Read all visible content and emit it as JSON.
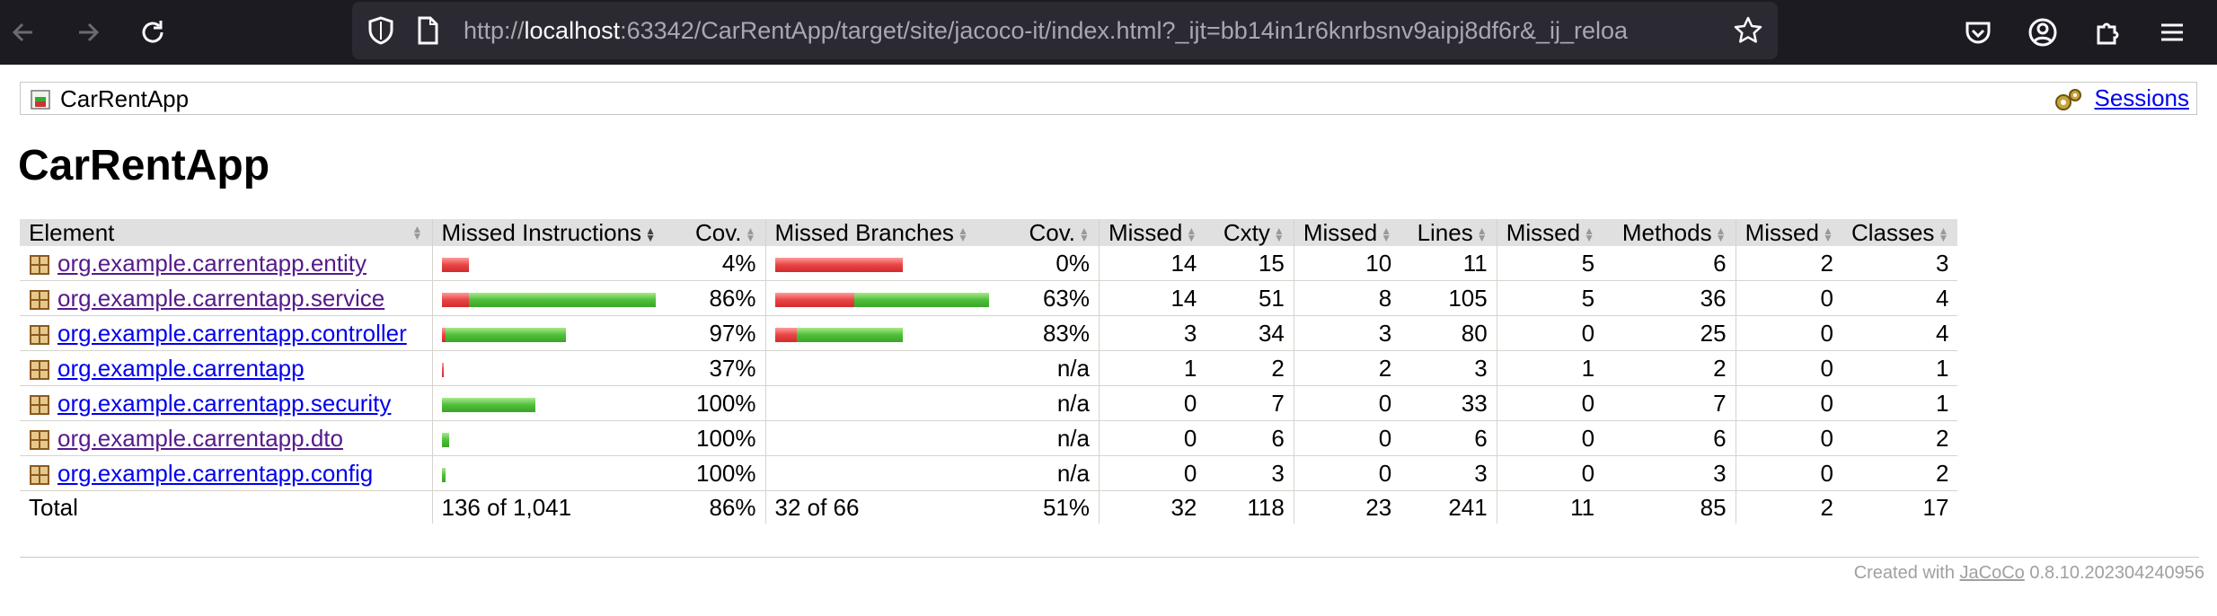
{
  "browser": {
    "url_prefix": "http://",
    "url_host": "localhost",
    "url_rest": ":63342/CarRentApp/target/site/jacoco-it/index.html?_ijt=bb14in1r6knrbsnv9aipj8df6r&_ij_reloa"
  },
  "breadcrumb": {
    "title": "CarRentApp",
    "sessions_label": "Sessions"
  },
  "page_title": "CarRentApp",
  "table": {
    "headers": [
      "Element",
      "Missed Instructions",
      "Cov.",
      "Missed Branches",
      "Cov.",
      "Missed",
      "Cxty",
      "Missed",
      "Lines",
      "Missed",
      "Methods",
      "Missed",
      "Classes"
    ],
    "rows": [
      {
        "name": "org.example.carrentapp.entity",
        "visited": true,
        "instr_bar": {
          "red": 30,
          "green": 0
        },
        "instr_cov": "4%",
        "branch_bar": {
          "red": 142,
          "green": 0
        },
        "branch_cov": "0%",
        "missed_cxty": "14",
        "cxty": "15",
        "missed_lines": "10",
        "lines": "11",
        "missed_methods": "5",
        "methods": "6",
        "missed_classes": "2",
        "classes": "3"
      },
      {
        "name": "org.example.carrentapp.service",
        "visited": true,
        "instr_bar": {
          "red": 30,
          "green": 208
        },
        "instr_cov": "86%",
        "branch_bar": {
          "red": 88,
          "green": 150
        },
        "branch_cov": "63%",
        "missed_cxty": "14",
        "cxty": "51",
        "missed_lines": "8",
        "lines": "105",
        "missed_methods": "5",
        "methods": "36",
        "missed_classes": "0",
        "classes": "4"
      },
      {
        "name": "org.example.carrentapp.controller",
        "visited": false,
        "instr_bar": {
          "red": 4,
          "green": 134
        },
        "instr_cov": "97%",
        "branch_bar": {
          "red": 24,
          "green": 118
        },
        "branch_cov": "83%",
        "missed_cxty": "3",
        "cxty": "34",
        "missed_lines": "3",
        "lines": "80",
        "missed_methods": "0",
        "methods": "25",
        "missed_classes": "0",
        "classes": "4"
      },
      {
        "name": "org.example.carrentapp",
        "visited": false,
        "instr_bar": {
          "red": 2,
          "green": 0
        },
        "instr_cov": "37%",
        "branch_bar": {
          "red": 0,
          "green": 0
        },
        "branch_cov": "n/a",
        "missed_cxty": "1",
        "cxty": "2",
        "missed_lines": "2",
        "lines": "3",
        "missed_methods": "1",
        "methods": "2",
        "missed_classes": "0",
        "classes": "1"
      },
      {
        "name": "org.example.carrentapp.security",
        "visited": false,
        "instr_bar": {
          "red": 0,
          "green": 104
        },
        "instr_cov": "100%",
        "branch_bar": {
          "red": 0,
          "green": 0
        },
        "branch_cov": "n/a",
        "missed_cxty": "0",
        "cxty": "7",
        "missed_lines": "0",
        "lines": "33",
        "missed_methods": "0",
        "methods": "7",
        "missed_classes": "0",
        "classes": "1"
      },
      {
        "name": "org.example.carrentapp.dto",
        "visited": true,
        "instr_bar": {
          "red": 0,
          "green": 8
        },
        "instr_cov": "100%",
        "branch_bar": {
          "red": 0,
          "green": 0
        },
        "branch_cov": "n/a",
        "missed_cxty": "0",
        "cxty": "6",
        "missed_lines": "0",
        "lines": "6",
        "missed_methods": "0",
        "methods": "6",
        "missed_classes": "0",
        "classes": "2"
      },
      {
        "name": "org.example.carrentapp.config",
        "visited": false,
        "instr_bar": {
          "red": 0,
          "green": 4
        },
        "instr_cov": "100%",
        "branch_bar": {
          "red": 0,
          "green": 0
        },
        "branch_cov": "n/a",
        "missed_cxty": "0",
        "cxty": "3",
        "missed_lines": "0",
        "lines": "3",
        "missed_methods": "0",
        "methods": "3",
        "missed_classes": "0",
        "classes": "2"
      }
    ],
    "total": {
      "label": "Total",
      "instr": "136 of 1,041",
      "instr_cov": "86%",
      "branch": "32 of 66",
      "branch_cov": "51%",
      "missed_cxty": "32",
      "cxty": "118",
      "missed_lines": "23",
      "lines": "241",
      "missed_methods": "11",
      "methods": "85",
      "missed_classes": "2",
      "classes": "17"
    }
  },
  "footer": {
    "prefix": "Created with ",
    "tool": "JaCoCo",
    "version": " 0.8.10.202304240956"
  },
  "colors": {
    "chrome_bg": "#1c1b22",
    "urlbar_bg": "#2b2a33",
    "header_bg": "#e0e0e0",
    "link": "#0000ee",
    "visited_link": "#551a8b",
    "bar_red": "#d42a2a",
    "bar_green": "#3aa42a"
  }
}
